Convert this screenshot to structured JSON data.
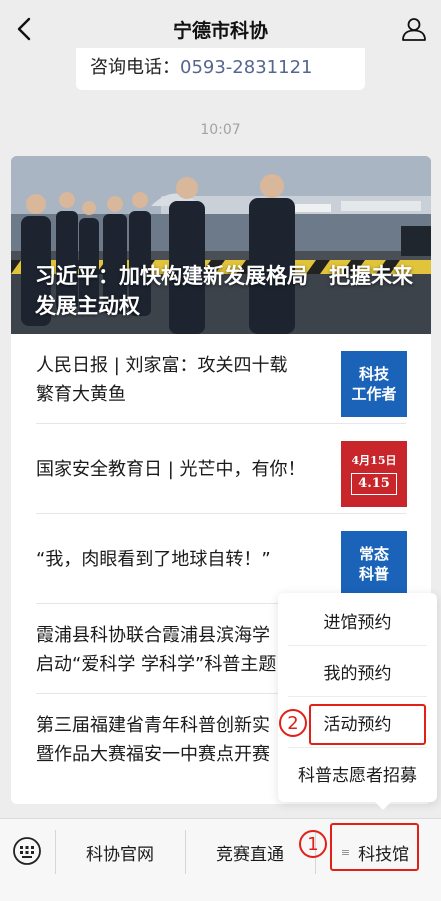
{
  "nav": {
    "title": "宁德市科协"
  },
  "consult": {
    "label": "咨询电话：",
    "phone": "0593-2831121"
  },
  "timestamp": "10:07",
  "hero": {
    "headline": "习近平：加快构建新发展格局　把握未来发展主动权"
  },
  "articles": [
    {
      "title_line1": "人民日报 | 刘家富：攻关四十载",
      "title_line2": "繁育大黄鱼",
      "thumb_text": [
        "科技",
        "工作者"
      ],
      "thumb_color": "#1a63b8"
    },
    {
      "title_line1": "国家安全教育日 | 光芒中，有你！",
      "title_line2": "",
      "thumb_text": [
        "4月15日",
        "4.15"
      ],
      "thumb_color": "#c8262a"
    },
    {
      "title_line1": "“我，肉眼看到了地球自转！”",
      "title_line2": "",
      "thumb_text": [
        "常态",
        "科普"
      ],
      "thumb_color": "#1a63b8"
    },
    {
      "title_line1": "霞浦县科协联合霞浦县滨海学",
      "title_line2": "启动“爱科学 学科学”科普主题",
      "thumb_text": [],
      "thumb_color": ""
    },
    {
      "title_line1": "第三届福建省青年科普创新实",
      "title_line2": "暨作品大赛福安一中赛点开赛",
      "thumb_text": [],
      "thumb_color": ""
    }
  ],
  "popup_menu": {
    "items": [
      "进馆预约",
      "我的预约",
      "活动预约",
      "科普志愿者招募"
    ]
  },
  "annotations": {
    "step1": "1",
    "step2": "2"
  },
  "bottom_bar": {
    "tabs": [
      "科协官网",
      "竞赛直通",
      "科技馆"
    ]
  },
  "colors": {
    "accent_red": "#e22018",
    "link_blue": "#56668f"
  }
}
